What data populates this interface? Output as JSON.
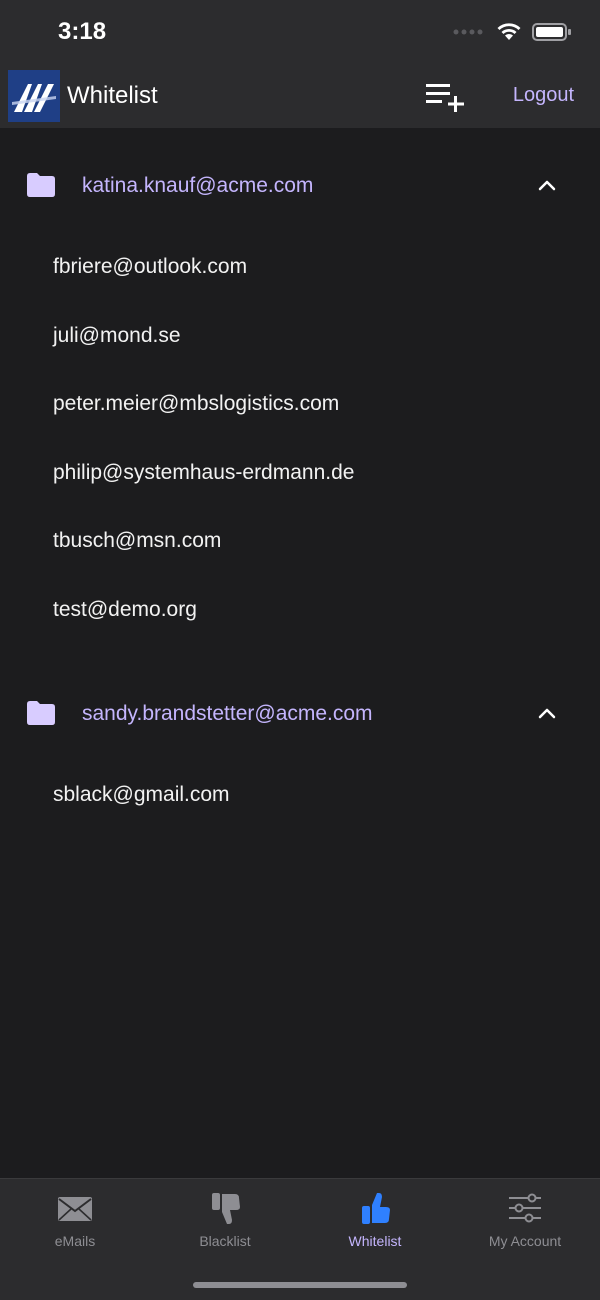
{
  "status_bar": {
    "time": "3:18"
  },
  "header": {
    "title": "Whitelist",
    "logout_label": "Logout"
  },
  "groups": [
    {
      "label": "katina.knauf@acme.com",
      "emails": [
        "fbriere@outlook.com",
        "juli@mond.se",
        "peter.meier@mbslogistics.com",
        "philip@systemhaus-erdmann.de",
        "tbusch@msn.com",
        "test@demo.org"
      ]
    },
    {
      "label": "sandy.brandstetter@acme.com",
      "emails": [
        "sblack@gmail.com"
      ]
    }
  ],
  "tabs": [
    {
      "label": "eMails",
      "icon": "mail-icon"
    },
    {
      "label": "Blacklist",
      "icon": "thumbs-down-icon"
    },
    {
      "label": "Whitelist",
      "icon": "thumbs-up-icon",
      "active": true
    },
    {
      "label": "My Account",
      "icon": "sliders-icon"
    }
  ],
  "colors": {
    "accent": "#c4b5fd",
    "active_tab_icon": "#2f80ff",
    "background": "#1c1c1e",
    "bar_background": "#2c2c2e"
  }
}
